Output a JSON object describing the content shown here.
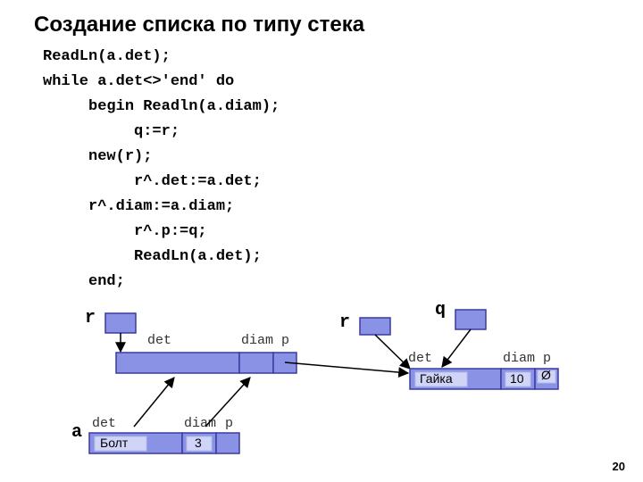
{
  "title": "Создание списка по типу стека",
  "code": "ReadLn(a.det);\nwhile a.det<>'end' do\n     begin Readln(a.diam);\n          q:=r;\n     new(r);\n          r^.det:=a.det;\n     r^.diam:=a.diam;\n          r^.p:=q;\n          ReadLn(a.det);\n     end;",
  "labels": {
    "r1": "r",
    "r2": "r",
    "q": "q",
    "a": "a",
    "det": "det",
    "diam": "diam",
    "p": "p"
  },
  "values": {
    "node2_det": "Гайка",
    "node2_diam": "10",
    "node2_p": "Ø",
    "a_det": "Болт",
    "a_diam": "3"
  },
  "page": "20",
  "colors": {
    "shapeFill": "#8a92e6",
    "shapeStroke": "#3a3aa0",
    "editFill": "#d0d4f6"
  }
}
